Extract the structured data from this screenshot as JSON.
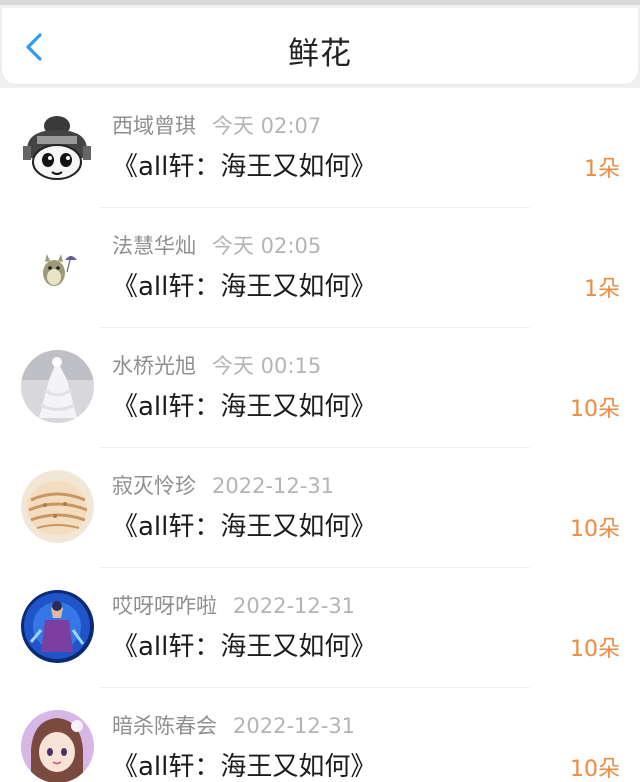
{
  "header": {
    "title": "鲜花",
    "back_icon": "chevron-left-icon",
    "accent_color": "#2b9cf0"
  },
  "list": {
    "items": [
      {
        "user": "西域曾琪",
        "time": "今天 02:07",
        "work": "《all轩：海王又如何》",
        "count": "1朵",
        "avatar": "cartoon-girl-bun-avatar"
      },
      {
        "user": "法慧华灿",
        "time": "今天 02:05",
        "work": "《all轩：海王又如何》",
        "count": "1朵",
        "avatar": "totoro-avatar"
      },
      {
        "user": "水桥光旭",
        "time": "今天 00:15",
        "work": "《all轩：海王又如何》",
        "count": "10朵",
        "avatar": "white-dress-avatar"
      },
      {
        "user": "寂灭怜珍",
        "time": "2022-12-31",
        "work": "《all轩：海王又如何》",
        "count": "10朵",
        "avatar": "seashell-avatar"
      },
      {
        "user": "哎呀呀咋啦",
        "time": "2022-12-31",
        "work": "《all轩：海王又如何》",
        "count": "10朵",
        "avatar": "blue-game-character-avatar"
      },
      {
        "user": "暗杀陈春会",
        "time": "2022-12-31",
        "work": "《all轩：海王又如何》",
        "count": "10朵",
        "avatar": "anime-girl-avatar"
      }
    ]
  },
  "colors": {
    "count": "#ef8a3e",
    "username": "#8f8f8f",
    "time": "#b4b4b4"
  }
}
